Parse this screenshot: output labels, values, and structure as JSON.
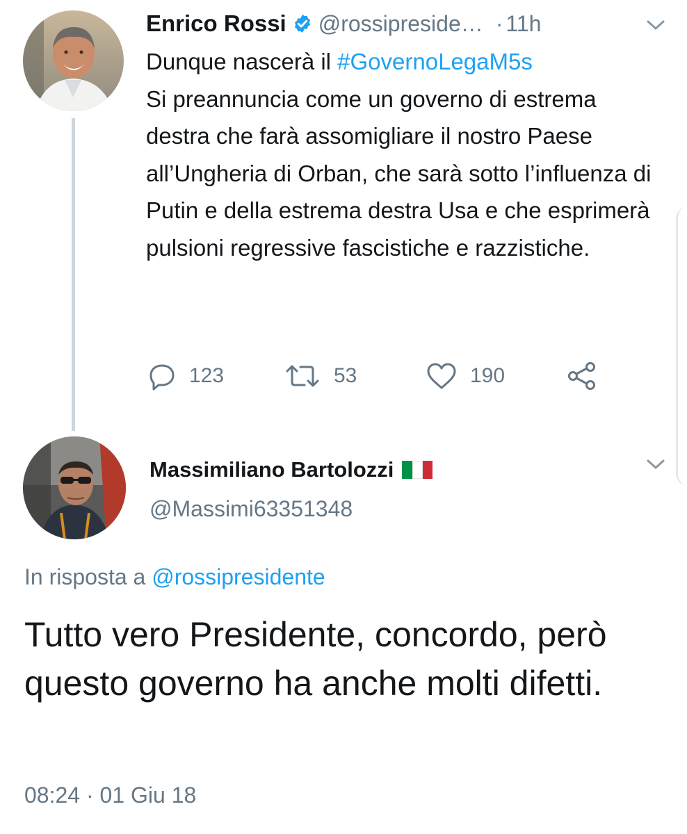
{
  "tweet1": {
    "author_name": "Enrico Rossi",
    "handle": "@rossipreside…",
    "separator": "·",
    "time": "11h",
    "text_lead": "Dunque nascerà il ",
    "hashtag": "#GovernoLegaM5s",
    "text_body": "Si preannuncia come un governo di estrema destra che farà assomigliare il nostro Paese all’Ungheria di Orban, che sarà sotto l’influenza di Putin e della estrema destra Usa e che esprimerà pulsioni regressive fascistiche e razzistiche.",
    "replies": "123",
    "retweets": "53",
    "likes": "190",
    "icons": [
      "verified-badge-icon",
      "chevron-down-icon",
      "reply-icon",
      "retweet-icon",
      "heart-icon",
      "share-icon"
    ]
  },
  "tweet2": {
    "author_name": "Massimiliano Bartolozzi",
    "flag_icon": "italy-flag-icon",
    "handle": "@Massimi63351348",
    "reply_prefix": "In risposta a ",
    "reply_mention": "@rossipresidente",
    "text": "Tutto vero Presidente,  concordo, però questo governo ha anche molti difetti.",
    "timestamp": "08:24 · 01 Giu 18"
  },
  "colors": {
    "accent": "#1da1f2",
    "secondary_text": "#657786",
    "primary_text": "#14171a",
    "thread_line": "#ccd6dd",
    "flag_green": "#009246",
    "flag_white": "#ffffff",
    "flag_red": "#ce2b37"
  }
}
